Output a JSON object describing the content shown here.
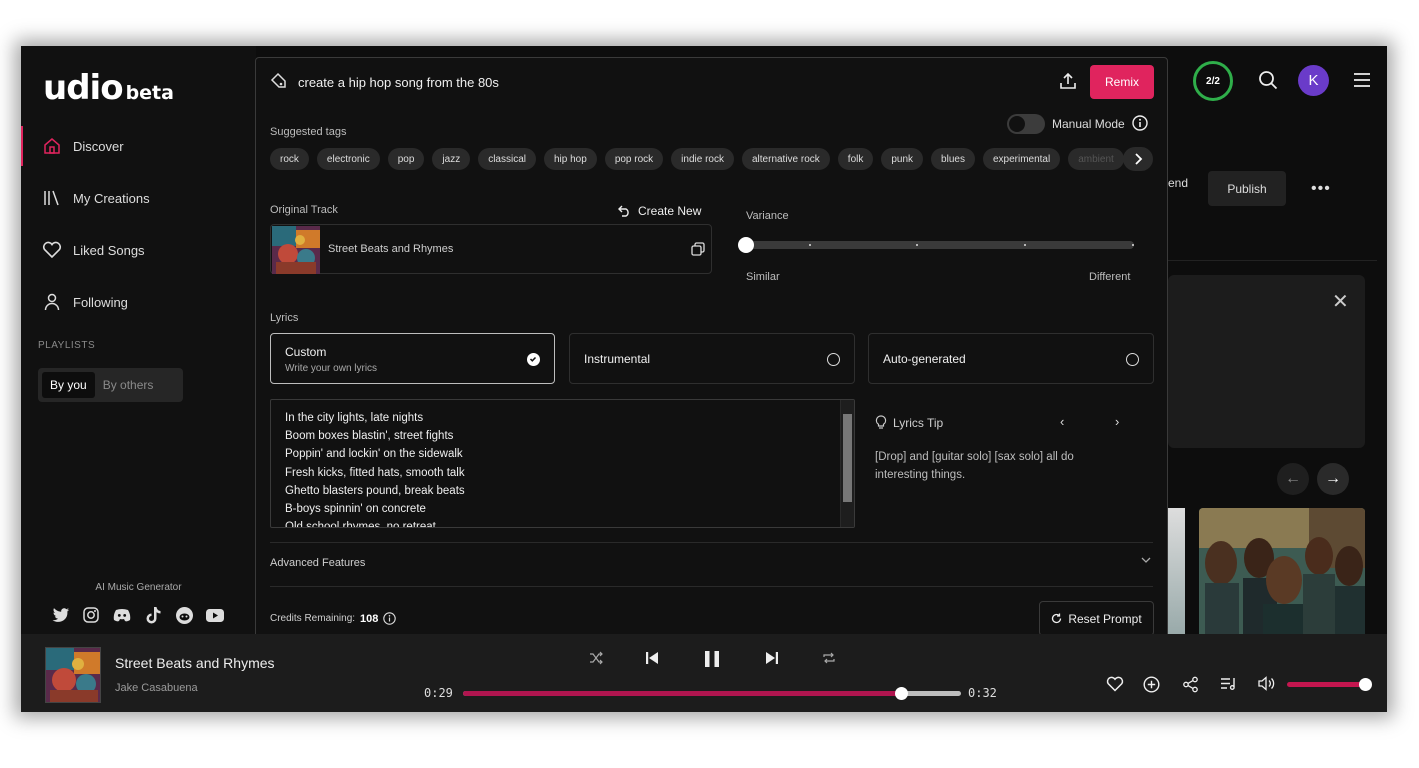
{
  "app": {
    "logo_text": "udio",
    "logo_suffix": "beta",
    "credit_ring": "2/2",
    "avatar_letter": "K"
  },
  "sidebar": {
    "items": [
      {
        "label": "Discover",
        "icon": "home-icon",
        "active": true
      },
      {
        "label": "My Creations",
        "icon": "library-icon"
      },
      {
        "label": "Liked Songs",
        "icon": "heart-icon"
      },
      {
        "label": "Following",
        "icon": "user-icon"
      }
    ],
    "playlists_title": "PLAYLISTS",
    "playlist_tabs": [
      "By you",
      "By others"
    ],
    "footer_text": "AI Music Generator",
    "socials": [
      "twitter-icon",
      "instagram-icon",
      "discord-icon",
      "tiktok-icon",
      "reddit-icon",
      "youtube-icon"
    ]
  },
  "background": {
    "end_label": "end",
    "publish_label": "Publish",
    "more_label": "•••"
  },
  "modal": {
    "prompt_text": "create a hip hop song from the 80s",
    "remix_label": "Remix",
    "manual_mode_label": "Manual Mode",
    "suggested_tags_label": "Suggested tags",
    "tags": [
      "rock",
      "electronic",
      "pop",
      "jazz",
      "classical",
      "hip hop",
      "pop rock",
      "indie rock",
      "alternative rock",
      "folk",
      "punk",
      "blues",
      "experimental",
      "ambient"
    ],
    "original_track_label": "Original Track",
    "create_new_label": "Create New",
    "track_name": "Street Beats and Rhymes",
    "variance_label": "Variance",
    "variance_min_label": "Similar",
    "variance_max_label": "Different",
    "variance_value": 0,
    "lyrics_label": "Lyrics",
    "lyric_options": [
      {
        "title": "Custom",
        "subtitle": "Write your own lyrics",
        "selected": true
      },
      {
        "title": "Instrumental",
        "subtitle": "",
        "selected": false
      },
      {
        "title": "Auto-generated",
        "subtitle": "",
        "selected": false
      }
    ],
    "lyrics_lines": [
      "In the city lights, late nights",
      "Boom boxes blastin', street fights",
      "Poppin' and lockin' on the sidewalk",
      "Fresh kicks, fitted hats, smooth talk",
      "Ghetto blasters pound, break beats",
      "B-boys spinnin' on concrete",
      "Old school rhymes, no retreat"
    ],
    "tip_title": "Lyrics Tip",
    "tip_text": "[Drop] and [guitar solo] [sax solo] all do interesting things.",
    "advanced_label": "Advanced Features",
    "credits_label": "Credits Remaining:",
    "credits_value": "108",
    "reset_label": "Reset Prompt"
  },
  "player": {
    "title": "Street Beats and Rhymes",
    "artist": "Jake Casabuena",
    "elapsed": "0:29",
    "remaining": "0:32",
    "progress": 0.88,
    "volume": 1.0
  },
  "colors": {
    "accent": "#e0245e",
    "progress": "#b0154f",
    "credit_ring": "#2fae4a",
    "avatar": "#6a3bc9"
  }
}
